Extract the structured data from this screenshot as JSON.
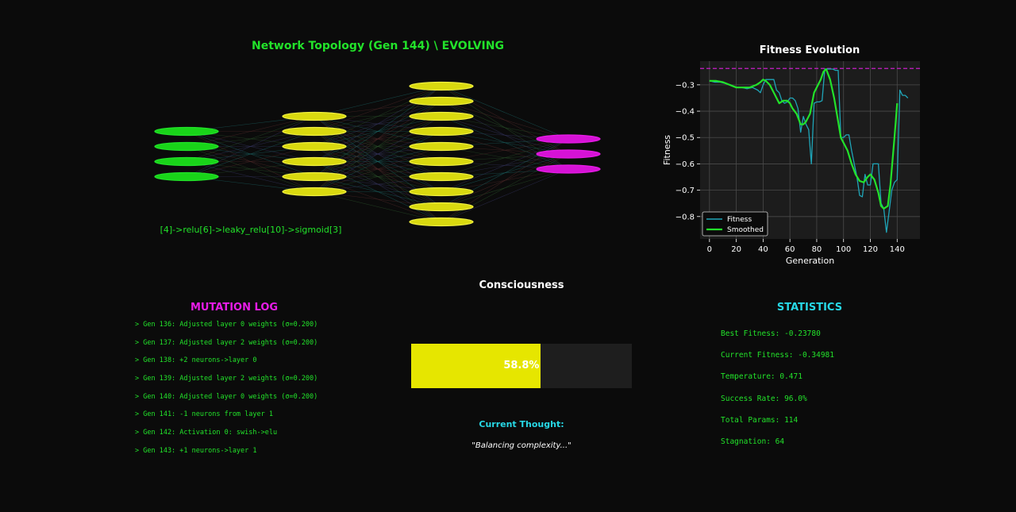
{
  "topology": {
    "title": "Network Topology (Gen 144) \\ EVOLVING",
    "architecture": "[4]->relu[6]->leaky_relu[10]->sigmoid[3]",
    "layers": [
      {
        "neurons": 4,
        "color": "#19d419"
      },
      {
        "neurons": 6,
        "color": "#d9d90f"
      },
      {
        "neurons": 10,
        "color": "#d9d90f"
      },
      {
        "neurons": 3,
        "color": "#d612d6"
      }
    ]
  },
  "chart_data": {
    "type": "line",
    "title": "Fitness Evolution",
    "xlabel": "Generation",
    "ylabel": "Fitness",
    "xlim": [
      -7,
      157
    ],
    "ylim": [
      -0.885,
      -0.21
    ],
    "xticks": [
      0,
      20,
      40,
      60,
      80,
      100,
      120,
      140
    ],
    "yticks": [
      -0.8,
      -0.7,
      -0.6,
      -0.5,
      -0.4,
      -0.3
    ],
    "grid": true,
    "legend": "lower-left",
    "best_line": {
      "y": -0.2378,
      "color": "#c81ec8"
    },
    "series": [
      {
        "name": "Fitness",
        "color": "#1fa5b8",
        "x": [
          0,
          4,
          8,
          12,
          16,
          20,
          24,
          28,
          32,
          36,
          38,
          40,
          42,
          44,
          46,
          48,
          50,
          52,
          54,
          56,
          58,
          60,
          62,
          64,
          66,
          68,
          70,
          72,
          74,
          76,
          78,
          80,
          82,
          84,
          86,
          88,
          90,
          92,
          94,
          96,
          98,
          100,
          102,
          104,
          106,
          108,
          110,
          112,
          114,
          116,
          118,
          120,
          122,
          124,
          126,
          128,
          130,
          132,
          134,
          136,
          138,
          140,
          142,
          144,
          146,
          148
        ],
        "values": [
          -0.285,
          -0.29,
          -0.29,
          -0.295,
          -0.3,
          -0.31,
          -0.31,
          -0.315,
          -0.31,
          -0.32,
          -0.33,
          -0.3,
          -0.28,
          -0.28,
          -0.28,
          -0.28,
          -0.32,
          -0.33,
          -0.36,
          -0.37,
          -0.365,
          -0.35,
          -0.35,
          -0.36,
          -0.39,
          -0.48,
          -0.42,
          -0.45,
          -0.47,
          -0.6,
          -0.37,
          -0.365,
          -0.365,
          -0.36,
          -0.24,
          -0.24,
          -0.24,
          -0.24,
          -0.245,
          -0.245,
          -0.5,
          -0.5,
          -0.49,
          -0.49,
          -0.55,
          -0.6,
          -0.65,
          -0.72,
          -0.725,
          -0.64,
          -0.68,
          -0.68,
          -0.6,
          -0.6,
          -0.6,
          -0.75,
          -0.77,
          -0.86,
          -0.78,
          -0.7,
          -0.67,
          -0.66,
          -0.32,
          -0.34,
          -0.34,
          -0.35
        ]
      },
      {
        "name": "Smoothed",
        "color": "#22e22a",
        "x": [
          0,
          5,
          10,
          15,
          20,
          25,
          30,
          35,
          38,
          40,
          42,
          45,
          48,
          50,
          52,
          55,
          58,
          60,
          62,
          65,
          68,
          70,
          72,
          75,
          78,
          80,
          83,
          85,
          87,
          90,
          93,
          96,
          98,
          100,
          103,
          106,
          109,
          112,
          115,
          118,
          120,
          123,
          126,
          128,
          130,
          133,
          135,
          138,
          140
        ],
        "values": [
          -0.285,
          -0.285,
          -0.29,
          -0.3,
          -0.31,
          -0.31,
          -0.31,
          -0.3,
          -0.29,
          -0.28,
          -0.285,
          -0.3,
          -0.33,
          -0.35,
          -0.37,
          -0.36,
          -0.36,
          -0.37,
          -0.39,
          -0.41,
          -0.45,
          -0.45,
          -0.44,
          -0.41,
          -0.33,
          -0.31,
          -0.28,
          -0.25,
          -0.24,
          -0.28,
          -0.35,
          -0.44,
          -0.5,
          -0.52,
          -0.55,
          -0.6,
          -0.64,
          -0.665,
          -0.67,
          -0.65,
          -0.64,
          -0.66,
          -0.71,
          -0.76,
          -0.77,
          -0.76,
          -0.68,
          -0.5,
          -0.37
        ]
      }
    ]
  },
  "mutation_log": {
    "title": "MUTATION LOG",
    "entries": [
      "> Gen 136: Adjusted layer 0 weights (σ=0.200)",
      "> Gen 137: Adjusted layer 2 weights (σ=0.200)",
      "> Gen 138: +2 neurons->layer 0",
      "> Gen 139: Adjusted layer 2 weights (σ=0.200)",
      "> Gen 140: Adjusted layer 0 weights (σ=0.200)",
      "> Gen 141: -1 neurons from layer 1",
      "> Gen 142: Activation 0: swish->elu",
      "> Gen 143: +1 neurons->layer 1"
    ]
  },
  "consciousness": {
    "title": "Consciousness",
    "level": 0.588,
    "level_label": "58.8%",
    "thought_label": "Current Thought:",
    "thought": "\"Balancing complexity...\""
  },
  "statistics": {
    "title": "STATISTICS",
    "items": [
      "Best Fitness: -0.23780",
      "Current Fitness: -0.34981",
      "Temperature: 0.471",
      "Success Rate: 96.0%",
      "Total Params: 114",
      "Stagnation: 64"
    ]
  }
}
